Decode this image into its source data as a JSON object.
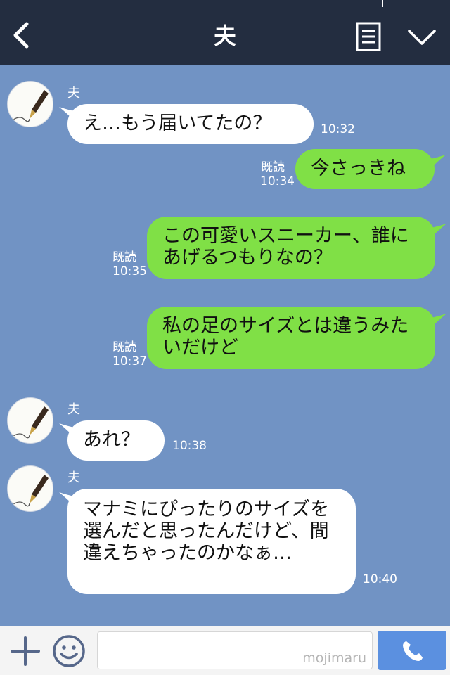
{
  "header": {
    "title": "夫"
  },
  "contact_name": "夫",
  "messages": [
    {
      "text": "え…もう届いてたの？",
      "time": "10:32"
    },
    {
      "text": "今さっきね",
      "read": "既読",
      "time": "10:34"
    },
    {
      "text": "この可愛いスニーカー、誰にあげるつもりなの？",
      "read": "既読",
      "time": "10:35"
    },
    {
      "text": "私の足のサイズとは違うみたいだけど",
      "read": "既読",
      "time": "10:37"
    },
    {
      "text": "あれ？",
      "time": "10:38"
    },
    {
      "text": "マナミにぴったりのサイズを選んだと思ったんだけど、間違えちゃったのかなぁ…",
      "time": "10:40"
    }
  ],
  "footer": {
    "watermark": "mojimaru"
  }
}
